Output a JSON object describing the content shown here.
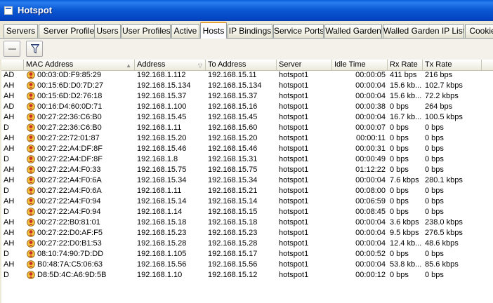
{
  "window": {
    "title": "Hotspot"
  },
  "tabs": [
    {
      "label": "Servers"
    },
    {
      "label": "Server Profiles"
    },
    {
      "label": "Users"
    },
    {
      "label": "User Profiles"
    },
    {
      "label": "Active"
    },
    {
      "label": "Hosts"
    },
    {
      "label": "IP Bindings"
    },
    {
      "label": "Service Ports"
    },
    {
      "label": "Walled Garden"
    },
    {
      "label": "Walled Garden IP List"
    },
    {
      "label": "Cookie"
    }
  ],
  "active_tab": "Hosts",
  "toolbar": {
    "remove_icon": "minus-icon",
    "filter_icon": "filter-icon"
  },
  "table": {
    "columns": [
      "",
      "MAC Address",
      "Address",
      "To Address",
      "Server",
      "Idle Time",
      "Rx Rate",
      "Tx Rate"
    ],
    "rows": [
      {
        "flags": "AD",
        "mac": "00:03:0D:F9:85:29",
        "address": "192.168.1.112",
        "to": "192.168.15.11",
        "server": "hotspot1",
        "idle": "00:00:05",
        "rx": "411 bps",
        "tx": "216 bps"
      },
      {
        "flags": "AH",
        "mac": "00:15:6D:D0:7D:27",
        "address": "192.168.15.134",
        "to": "192.168.15.134",
        "server": "hotspot1",
        "idle": "00:00:04",
        "rx": "15.6 kb...",
        "tx": "102.7 kbps"
      },
      {
        "flags": "AH",
        "mac": "00:15:6D:D2:76:18",
        "address": "192.168.15.37",
        "to": "192.168.15.37",
        "server": "hotspot1",
        "idle": "00:00:04",
        "rx": "15.6 kb...",
        "tx": "72.2 kbps"
      },
      {
        "flags": "AD",
        "mac": "00:16:D4:60:0D:71",
        "address": "192.168.1.100",
        "to": "192.168.15.16",
        "server": "hotspot1",
        "idle": "00:00:38",
        "rx": "0 bps",
        "tx": "264 bps"
      },
      {
        "flags": "AH",
        "mac": "00:27:22:36:C6:B0",
        "address": "192.168.15.45",
        "to": "192.168.15.45",
        "server": "hotspot1",
        "idle": "00:00:04",
        "rx": "16.7 kb...",
        "tx": "100.5 kbps"
      },
      {
        "flags": "D",
        "mac": "00:27:22:36:C6:B0",
        "address": "192.168.1.11",
        "to": "192.168.15.60",
        "server": "hotspot1",
        "idle": "00:00:07",
        "rx": "0 bps",
        "tx": "0 bps"
      },
      {
        "flags": "AH",
        "mac": "00:27:22:72:01:87",
        "address": "192.168.15.20",
        "to": "192.168.15.20",
        "server": "hotspot1",
        "idle": "00:00:11",
        "rx": "0 bps",
        "tx": "0 bps"
      },
      {
        "flags": "AH",
        "mac": "00:27:22:A4:DF:8F",
        "address": "192.168.15.46",
        "to": "192.168.15.46",
        "server": "hotspot1",
        "idle": "00:00:31",
        "rx": "0 bps",
        "tx": "0 bps"
      },
      {
        "flags": "D",
        "mac": "00:27:22:A4:DF:8F",
        "address": "192.168.1.8",
        "to": "192.168.15.31",
        "server": "hotspot1",
        "idle": "00:00:49",
        "rx": "0 bps",
        "tx": "0 bps"
      },
      {
        "flags": "AH",
        "mac": "00:27:22:A4:F0:33",
        "address": "192.168.15.75",
        "to": "192.168.15.75",
        "server": "hotspot1",
        "idle": "01:12:22",
        "rx": "0 bps",
        "tx": "0 bps"
      },
      {
        "flags": "AH",
        "mac": "00:27:22:A4:F0:6A",
        "address": "192.168.15.34",
        "to": "192.168.15.34",
        "server": "hotspot1",
        "idle": "00:00:04",
        "rx": "7.6 kbps",
        "tx": "280.1 kbps"
      },
      {
        "flags": "D",
        "mac": "00:27:22:A4:F0:6A",
        "address": "192.168.1.11",
        "to": "192.168.15.21",
        "server": "hotspot1",
        "idle": "00:08:00",
        "rx": "0 bps",
        "tx": "0 bps"
      },
      {
        "flags": "AH",
        "mac": "00:27:22:A4:F0:94",
        "address": "192.168.15.14",
        "to": "192.168.15.14",
        "server": "hotspot1",
        "idle": "00:06:59",
        "rx": "0 bps",
        "tx": "0 bps"
      },
      {
        "flags": "D",
        "mac": "00:27:22:A4:F0:94",
        "address": "192.168.1.14",
        "to": "192.168.15.15",
        "server": "hotspot1",
        "idle": "00:08:45",
        "rx": "0 bps",
        "tx": "0 bps"
      },
      {
        "flags": "AH",
        "mac": "00:27:22:B0:81:01",
        "address": "192.168.15.18",
        "to": "192.168.15.18",
        "server": "hotspot1",
        "idle": "00:00:04",
        "rx": "3.6 kbps",
        "tx": "238.0 kbps"
      },
      {
        "flags": "AH",
        "mac": "00:27:22:D0:AF:F5",
        "address": "192.168.15.23",
        "to": "192.168.15.23",
        "server": "hotspot1",
        "idle": "00:00:04",
        "rx": "9.5 kbps",
        "tx": "276.5 kbps"
      },
      {
        "flags": "AH",
        "mac": "00:27:22:D0:B1:53",
        "address": "192.168.15.28",
        "to": "192.168.15.28",
        "server": "hotspot1",
        "idle": "00:00:04",
        "rx": "12.4 kb...",
        "tx": "48.6 kbps"
      },
      {
        "flags": "D",
        "mac": "08:10:74:90:7D:DD",
        "address": "192.168.1.105",
        "to": "192.168.15.17",
        "server": "hotspot1",
        "idle": "00:00:52",
        "rx": "0 bps",
        "tx": "0 bps"
      },
      {
        "flags": "AH",
        "mac": "B0:48:7A:C5:06:63",
        "address": "192.168.15.56",
        "to": "192.168.15.56",
        "server": "hotspot1",
        "idle": "00:00:04",
        "rx": "53.8 kb...",
        "tx": "85.6 kbps"
      },
      {
        "flags": "D",
        "mac": "D8:5D:4C:A6:9D:5B",
        "address": "192.168.1.10",
        "to": "192.168.15.12",
        "server": "hotspot1",
        "idle": "00:00:12",
        "rx": "0 bps",
        "tx": "0 bps"
      }
    ]
  },
  "colors": {
    "titlebar": "#0b5ad4",
    "active_tab_accent": "#e8a33b",
    "host_icon": "#c8322a"
  },
  "row_icon": "host-icon"
}
